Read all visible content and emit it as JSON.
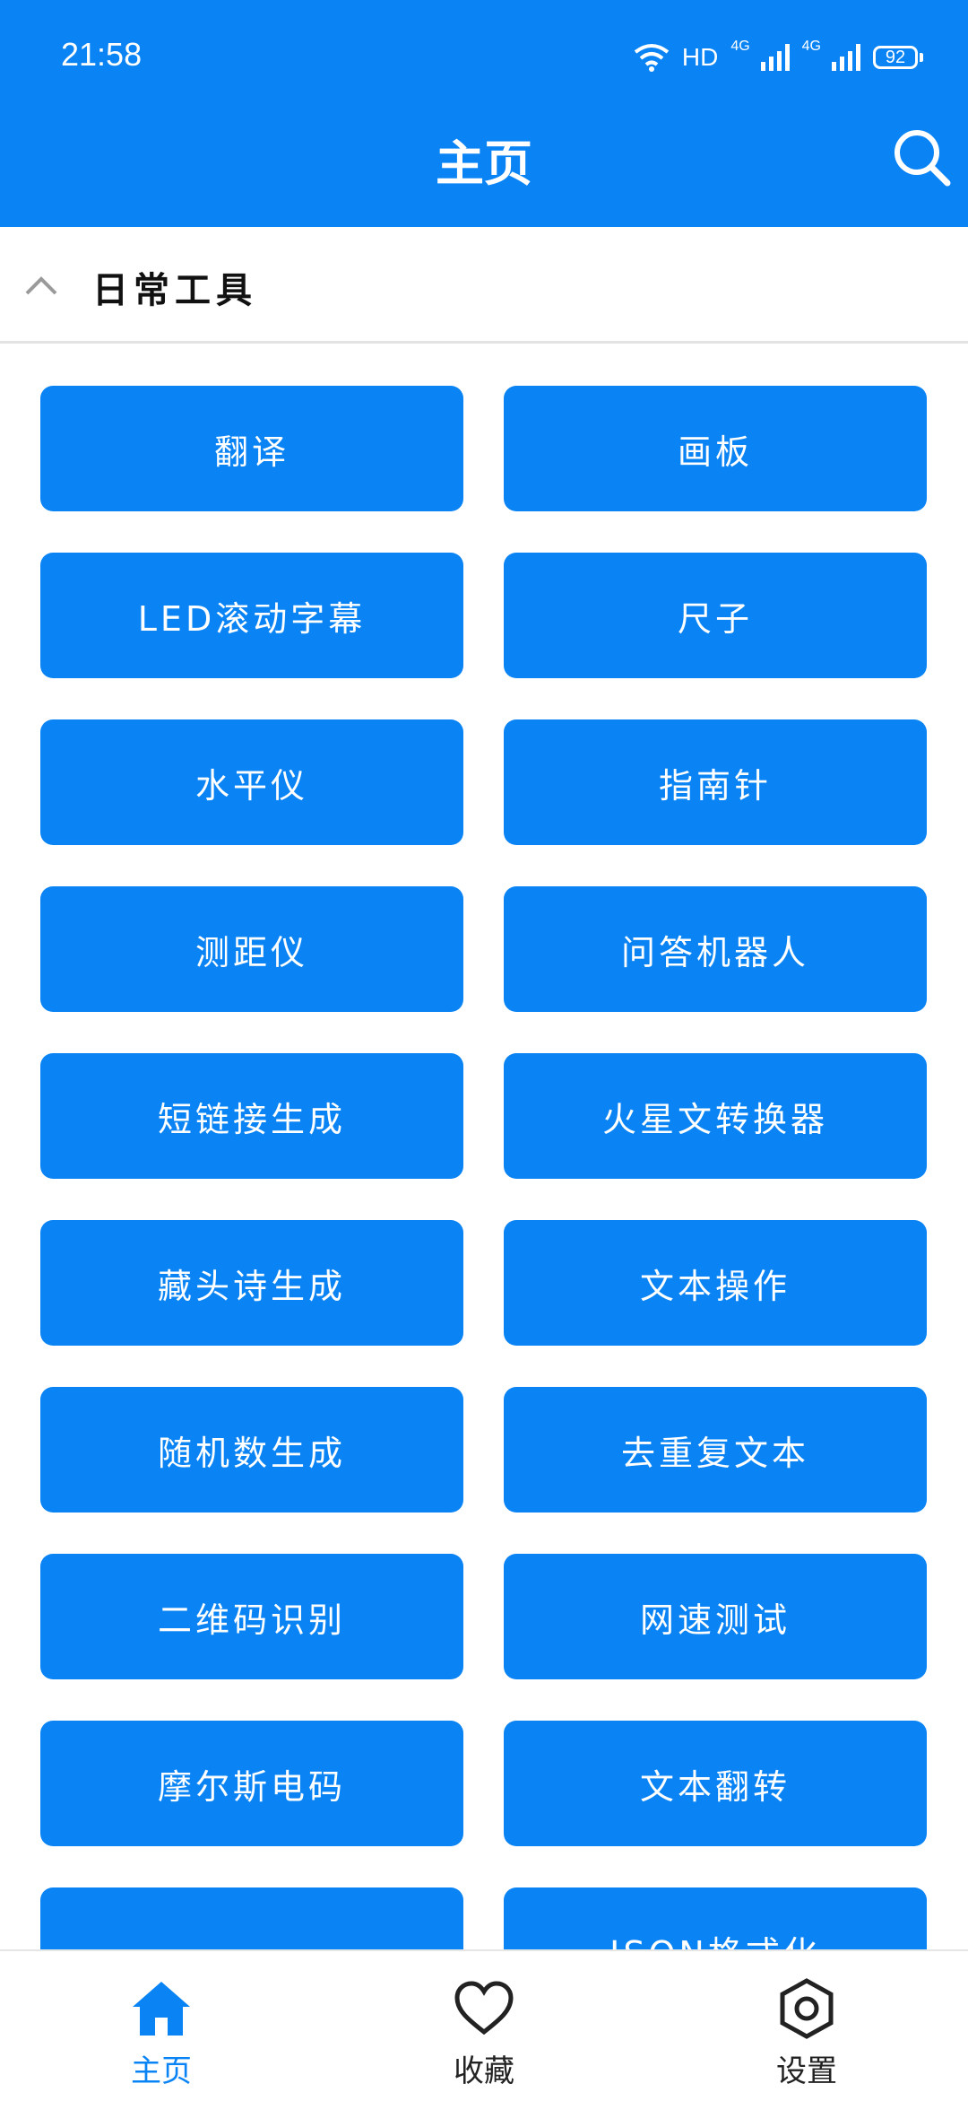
{
  "status_bar": {
    "time": "21:58",
    "network_1": "HD",
    "sim1_label": "4G",
    "sim2_label": "4G",
    "battery": "92"
  },
  "header": {
    "title": "主页",
    "search_icon": "search-icon"
  },
  "section": {
    "title": "日常工具",
    "toggle_icon": "chevron-up-icon"
  },
  "tools": [
    "翻译",
    "画板",
    "LED滚动字幕",
    "尺子",
    "水平仪",
    "指南针",
    "测距仪",
    "问答机器人",
    "短链接生成",
    "火星文转换器",
    "藏头诗生成",
    "文本操作",
    "随机数生成",
    "去重复文本",
    "二维码识别",
    "网速测试",
    "摩尔斯电码",
    "文本翻转",
    "",
    "JSON格式化"
  ],
  "bottom_nav": {
    "items": [
      {
        "label": "主页",
        "icon": "home-icon",
        "active": true
      },
      {
        "label": "收藏",
        "icon": "heart-icon",
        "active": false
      },
      {
        "label": "设置",
        "icon": "settings-icon",
        "active": false
      }
    ]
  },
  "colors": {
    "accent": "#0a84f5",
    "background": "#ffffff"
  }
}
